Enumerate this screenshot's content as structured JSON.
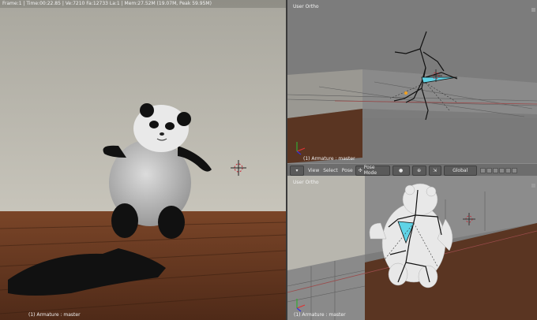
{
  "render_view": {
    "status": "Frame:1 | Time:00:22.85 | Ve:7210 Fa:12733 La:1 | Mem:27.52M (19.07M, Peak 59.95M)",
    "footer": "(1) Armature : master"
  },
  "ortho_top": {
    "label": "User Ortho",
    "footer": "(1) Armature : master"
  },
  "ortho_bottom": {
    "label": "User Ortho",
    "footer": "(1) Armature : master"
  },
  "header": {
    "menu_view": "View",
    "menu_select": "Select",
    "menu_pose": "Pose",
    "mode": "Pose Mode",
    "orientation": "Global"
  },
  "colors": {
    "accent_bone": "#5fd3e6",
    "floor_wood": "#6b3a22",
    "wall": "#b9b6ad"
  }
}
